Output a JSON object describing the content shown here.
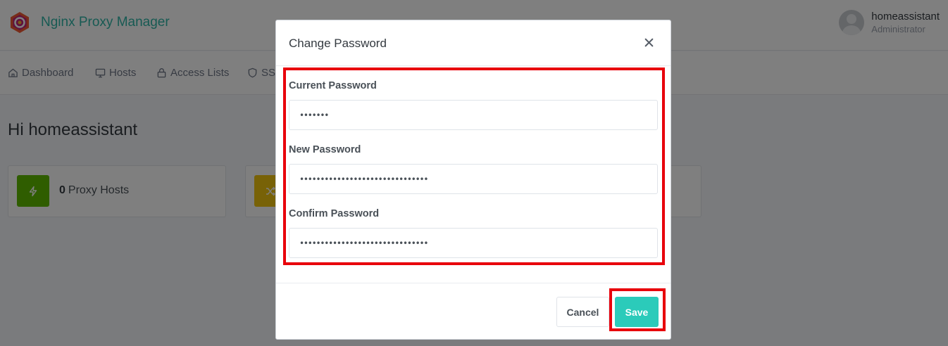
{
  "app": {
    "brand_name": "Nginx Proxy Manager",
    "user_name": "homeassistant",
    "user_role": "Administrator"
  },
  "nav": {
    "items": [
      {
        "label": "Dashboard",
        "icon": "home-icon"
      },
      {
        "label": "Hosts",
        "icon": "monitor-icon"
      },
      {
        "label": "Access Lists",
        "icon": "lock-icon"
      },
      {
        "label": "SSL",
        "icon": "shield-icon"
      }
    ]
  },
  "dashboard": {
    "greeting": "Hi homeassistant",
    "cards": [
      {
        "count": "0",
        "label": "Proxy Hosts",
        "color": "#5eba00",
        "icon": "bolt-icon"
      },
      {
        "count": "",
        "label": "",
        "color": "#f1c40f",
        "icon": "shuffle-icon"
      }
    ]
  },
  "modal": {
    "title": "Change Password",
    "fields": [
      {
        "label": "Current Password",
        "value": "•••••••"
      },
      {
        "label": "New Password",
        "value": "•••••••••••••••••••••••••••••••"
      },
      {
        "label": "Confirm Password",
        "value": "•••••••••••••••••••••••••••••••"
      }
    ],
    "cancel_label": "Cancel",
    "save_label": "Save"
  },
  "colors": {
    "accent": "#2bcbba",
    "brand_text": "#2fb5a6",
    "highlight": "#e8000b"
  }
}
